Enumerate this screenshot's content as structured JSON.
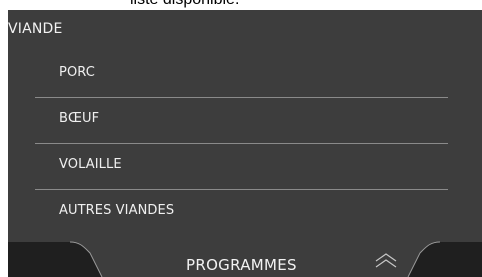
{
  "top_strip_text": "liste disponible.",
  "screen": {
    "title": "VIANDE",
    "items": [
      {
        "label": "PORC"
      },
      {
        "label": "BŒUF"
      },
      {
        "label": "VOLAILLE"
      },
      {
        "label": "AUTRES VIANDES"
      }
    ]
  },
  "bottom_bar": {
    "label": "PROGRAMMES",
    "icon": "chevron-up-double-icon"
  },
  "colors": {
    "screen_bg": "#3d3d3d",
    "text": "#f2f2f2",
    "divider": "#8a8a8a"
  }
}
